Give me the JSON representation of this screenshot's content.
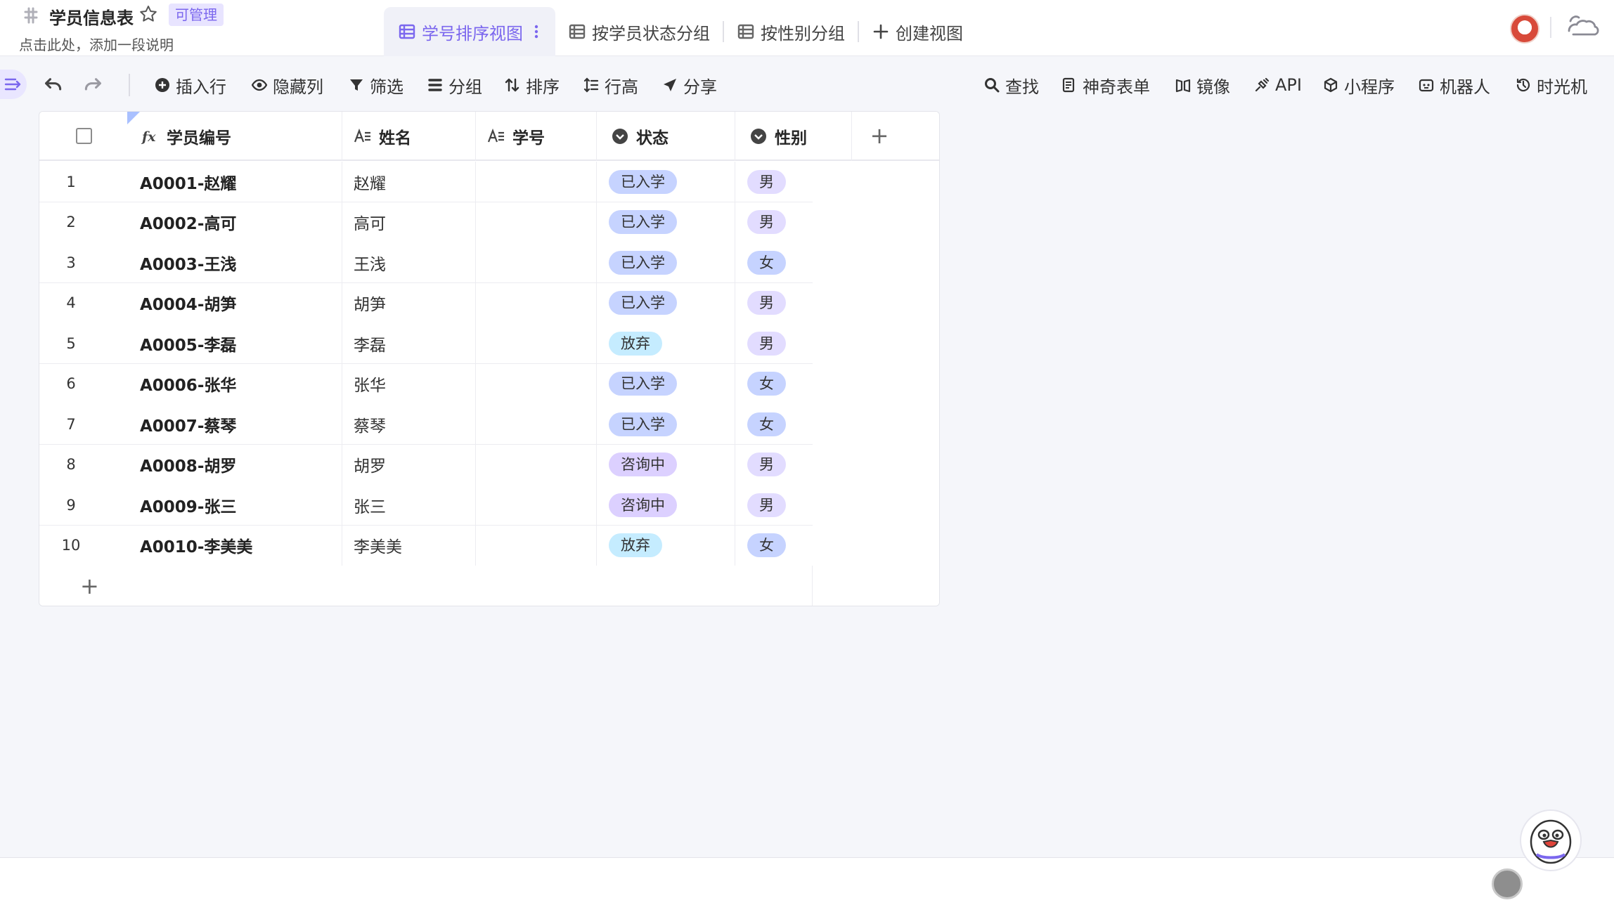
{
  "sheet": {
    "title": "学员信息表",
    "permission_badge": "可管理",
    "description": "点击此处，添加一段说明"
  },
  "views": [
    {
      "label": "学号排序视图",
      "active": true
    },
    {
      "label": "按学员状态分组",
      "active": false
    },
    {
      "label": "按性别分组",
      "active": false
    },
    {
      "label": "创建视图",
      "active": false
    }
  ],
  "toolbar": {
    "left": [
      "插入行",
      "隐藏列",
      "筛选",
      "分组",
      "排序",
      "行高",
      "分享"
    ],
    "right": [
      "查找",
      "神奇表单",
      "镜像",
      "API",
      "小程序",
      "机器人",
      "时光机"
    ]
  },
  "columns": [
    {
      "label": "学员编号",
      "type": "formula"
    },
    {
      "label": "姓名",
      "type": "text"
    },
    {
      "label": "学号",
      "type": "text"
    },
    {
      "label": "状态",
      "type": "single-select"
    },
    {
      "label": "性别",
      "type": "single-select"
    }
  ],
  "rows": [
    {
      "num": "1",
      "code": "A0001-赵耀",
      "name": "赵耀",
      "student_id": "",
      "status": "已入学",
      "gender": "男"
    },
    {
      "num": "2",
      "code": "A0002-高可",
      "name": "高可",
      "student_id": "",
      "status": "已入学",
      "gender": "男"
    },
    {
      "num": "3",
      "code": "A0003-王浅",
      "name": "王浅",
      "student_id": "",
      "status": "已入学",
      "gender": "女"
    },
    {
      "num": "4",
      "code": "A0004-胡笋",
      "name": "胡笋",
      "student_id": "",
      "status": "已入学",
      "gender": "男"
    },
    {
      "num": "5",
      "code": "A0005-李磊",
      "name": "李磊",
      "student_id": "",
      "status": "放弃",
      "gender": "男"
    },
    {
      "num": "6",
      "code": "A0006-张华",
      "name": "张华",
      "student_id": "",
      "status": "已入学",
      "gender": "女"
    },
    {
      "num": "7",
      "code": "A0007-蔡琴",
      "name": "蔡琴",
      "student_id": "",
      "status": "已入学",
      "gender": "女"
    },
    {
      "num": "8",
      "code": "A0008-胡罗",
      "name": "胡罗",
      "student_id": "",
      "status": "咨询中",
      "gender": "男"
    },
    {
      "num": "9",
      "code": "A0009-张三",
      "name": "张三",
      "student_id": "",
      "status": "咨询中",
      "gender": "男"
    },
    {
      "num": "10",
      "code": "A0010-李美美",
      "name": "李美美",
      "student_id": "",
      "status": "放弃",
      "gender": "女"
    }
  ],
  "colors": {
    "accent": "#7b67ee",
    "status_enrolled": "#c6d3ff",
    "status_quit": "#c5ecff",
    "status_consulting": "#dcd0ff",
    "gender_male": "#e2dcff",
    "gender_female": "#c6d3ff"
  }
}
